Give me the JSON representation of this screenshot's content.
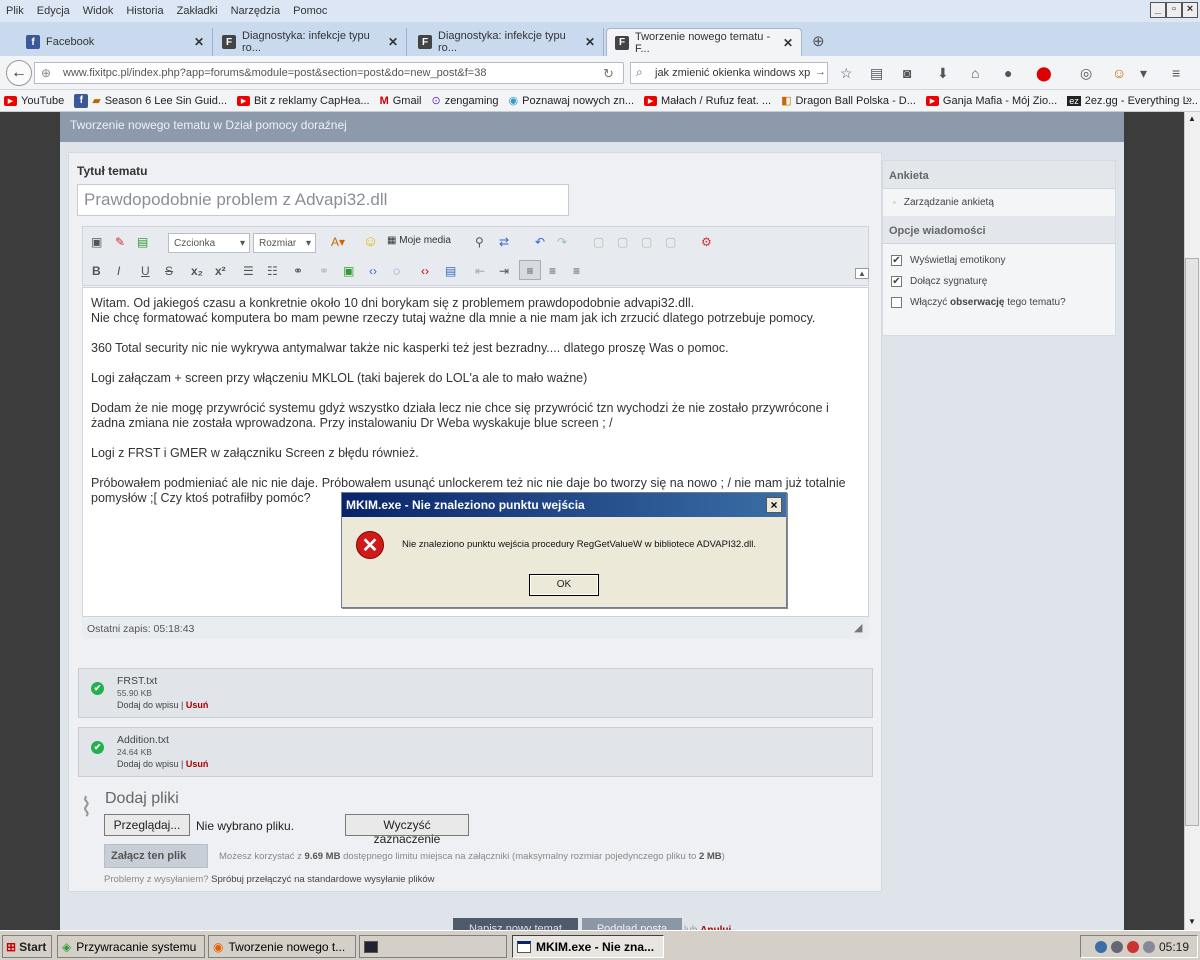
{
  "menubar": {
    "items": [
      "Plik",
      "Edycja",
      "Widok",
      "Historia",
      "Zakładki",
      "Narzędzia",
      "Pomoc"
    ]
  },
  "tabs": [
    {
      "label": "Facebook",
      "icon": "facebook-icon"
    },
    {
      "label": "Diagnostyka: infekcje typu ro...",
      "icon": "forum-icon"
    },
    {
      "label": "Diagnostyka: infekcje typu ro...",
      "icon": "forum-icon"
    },
    {
      "label": "Tworzenie nowego tematu - F...",
      "icon": "forum-icon"
    }
  ],
  "nav": {
    "url": "www.fixitpc.pl/index.php?app=forums&module=post&section=post&do=new_post&f=38",
    "search": "jak zmienić okienka windows xp"
  },
  "bookmarks": [
    "YouTube",
    "Season 6 Lee Sin Guid...",
    "Bit z reklamy CapHea...",
    "Gmail",
    "zengaming",
    "Poznawaj nowych zn...",
    "Małach / Rufuz feat. ...",
    "Dragon Ball Polska - D...",
    "Ganja Mafia - Mój Zio...",
    "2ez.gg - Everything L..."
  ],
  "page": {
    "header": "Tworzenie nowego tematu w Dział pomocy doraźnej",
    "title_label": "Tytuł tematu",
    "title_value": "Prawdopodobnie problem z Advapi32.dll",
    "toolbar": {
      "font": "Czcionka",
      "size": "Rozmiar",
      "media": "Moje media"
    },
    "editor_paragraphs": [
      "Witam. Od jakiegoś czasu a konkretnie około 10 dni borykam się z problemem prawdopodobnie advapi32.dll.\nNie chcę formatować komputera bo mam pewne rzeczy tutaj ważne dla mnie a nie mam jak ich zrzucić dlatego potrzebuje pomocy.",
      "360 Total security nic nie wykrywa antymalwar także nic kasperki też jest bezradny.... dlatego proszę Was o pomoc.",
      "Logi załączam + screen przy włączeniu MKLOL (taki bajerek do LOL'a ale to mało ważne)",
      "Dodam że nie mogę przywrócić systemu gdyż wszystko działa lecz nie chce się przywrócić tzn wychodzi że nie zostało przywrócone i żadna zmiana nie została wprowadzona. Przy instalowaniu Dr Weba wyskakuje blue screen ; /",
      "Logi z FRST i GMER w załączniku Screen z błędu również.",
      "Próbowałem podmieniać ale nic nie daje. Próbowałem usunąć unlockerem też nic nie daje bo tworzy się na nowo ; / nie mam już totalnie pomysłów ;[ Czy ktoś potrafiłby pomóc?"
    ],
    "last_save": "Ostatni zapis: 05:18:43",
    "attachments": [
      {
        "name": "FRST.txt",
        "size": "55.90 KB",
        "insert": "Dodaj do wpisu",
        "remove": "Usuń"
      },
      {
        "name": "Addition.txt",
        "size": "24.64 KB",
        "insert": "Dodaj do wpisu",
        "remove": "Usuń"
      }
    ],
    "upload": {
      "title": "Dodaj pliki",
      "browse": "Przeglądaj...",
      "nofile": "Nie wybrano pliku.",
      "clear": "Wyczyść zaznaczenie",
      "attach": "Załącz ten plik",
      "hint_pre": "Możesz korzystać z ",
      "hint_limit": "9.69 MB",
      "hint_mid": " dostępnego limitu miejsca na załączniki (maksymalny rozmiar pojedynczego pliku to ",
      "hint_max": "2 MB",
      "hint_end": ")",
      "problems": "Problemy z wysyłaniem? ",
      "problems_link": "Spróbuj przełączyć na standardowe wysyłanie plików"
    },
    "buttons": {
      "new_topic": "Napisz nowy temat",
      "preview": "Podgląd posta",
      "or": "lub",
      "cancel": "Anuluj"
    }
  },
  "sidebar": {
    "poll_header": "Ankieta",
    "poll_manage": "Zarządzanie ankietą",
    "options_header": "Opcje wiadomości",
    "opt1": "Wyświetlaj emotikony",
    "opt2": "Dołącz sygnaturę",
    "opt3_pre": "Włączyć ",
    "opt3_bold": "obserwację",
    "opt3_post": " tego tematu?"
  },
  "dialog": {
    "title": "MKIM.exe - Nie znaleziono punktu wejścia",
    "message": "Nie znaleziono punktu wejścia procedury RegGetValueW w bibliotece ADVAPI32.dll.",
    "ok": "OK"
  },
  "taskbar": {
    "start": "Start",
    "items": [
      "Przywracanie systemu",
      "Tworzenie nowego t...",
      "",
      "MKIM.exe - Nie zna..."
    ],
    "clock": "05:19"
  },
  "colors": {
    "accent": "#0a246a",
    "error": "#d01919",
    "success": "#22b14c",
    "link_remove": "#aa0000"
  }
}
